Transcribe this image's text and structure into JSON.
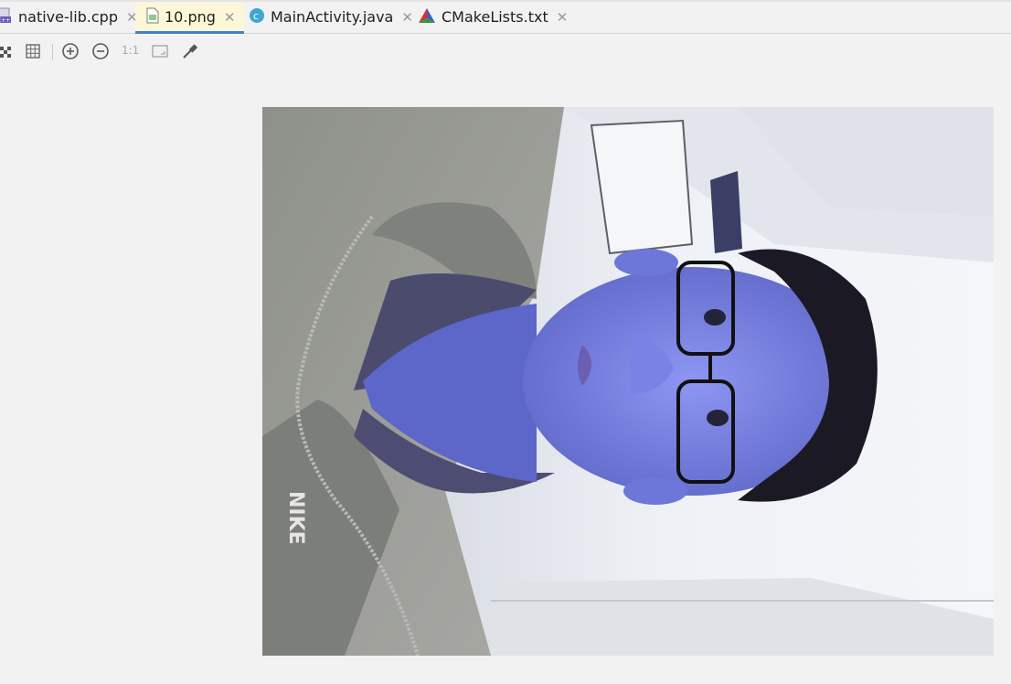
{
  "tabs": [
    {
      "label": "native-lib.cpp",
      "icon": "cpp-file-icon",
      "active": false
    },
    {
      "label": "10.png",
      "icon": "image-file-icon",
      "active": true
    },
    {
      "label": "MainActivity.java",
      "icon": "java-class-icon",
      "active": false
    },
    {
      "label": "CMakeLists.txt",
      "icon": "cmake-file-icon",
      "active": false
    }
  ],
  "toolbar": {
    "actual_size_label": "1:1",
    "icons": [
      "chessboard-icon",
      "grid-icon",
      "zoom-in-icon",
      "zoom-out-icon",
      "actual-size-icon",
      "fit-zoom-icon",
      "color-picker-icon"
    ]
  },
  "image_view": {
    "subject": "rotated photo of a man with glasses in a grey NIKE hoodie, blue-tinted",
    "hoodie_text": "NIKE"
  },
  "colors": {
    "tab_active_bg": "#fcf8d7",
    "tab_active_underline": "#4083c9",
    "background": "#f2f2f2"
  }
}
